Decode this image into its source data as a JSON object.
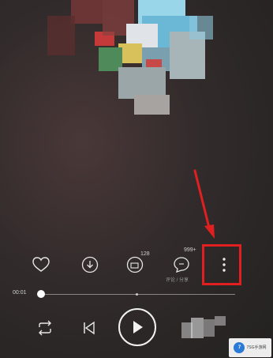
{
  "player": {
    "time_elapsed": "00:01",
    "progress_fraction": 0.01
  },
  "actions": {
    "download_badge": "",
    "comment_count": "128",
    "share_count": "999+",
    "share_sub": "评论 / 分享"
  },
  "watermark": {
    "logo_text": "7",
    "brand_text": "7SG手游网"
  },
  "colors": {
    "highlight": "#e02020",
    "background": "#2e2828"
  }
}
